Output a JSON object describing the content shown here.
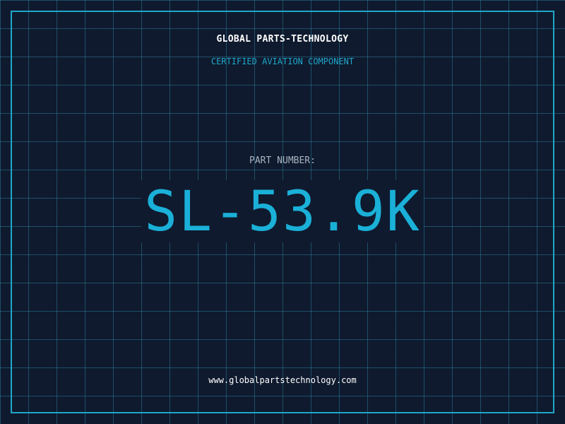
{
  "header": {
    "company_name": "GLOBAL PARTS-TECHNOLOGY",
    "subtitle": "CERTIFIED AVIATION COMPONENT"
  },
  "part": {
    "label": "PART NUMBER:",
    "number": "SL-53.9K"
  },
  "footer": {
    "website": "www.globalpartstechnology.com"
  },
  "colors": {
    "background": "#0f1a2e",
    "grid": "#2a7896",
    "accent": "#1fa7c9",
    "part_number": "#1ab0d8",
    "label": "#a8b2c0",
    "text": "#ffffff"
  }
}
